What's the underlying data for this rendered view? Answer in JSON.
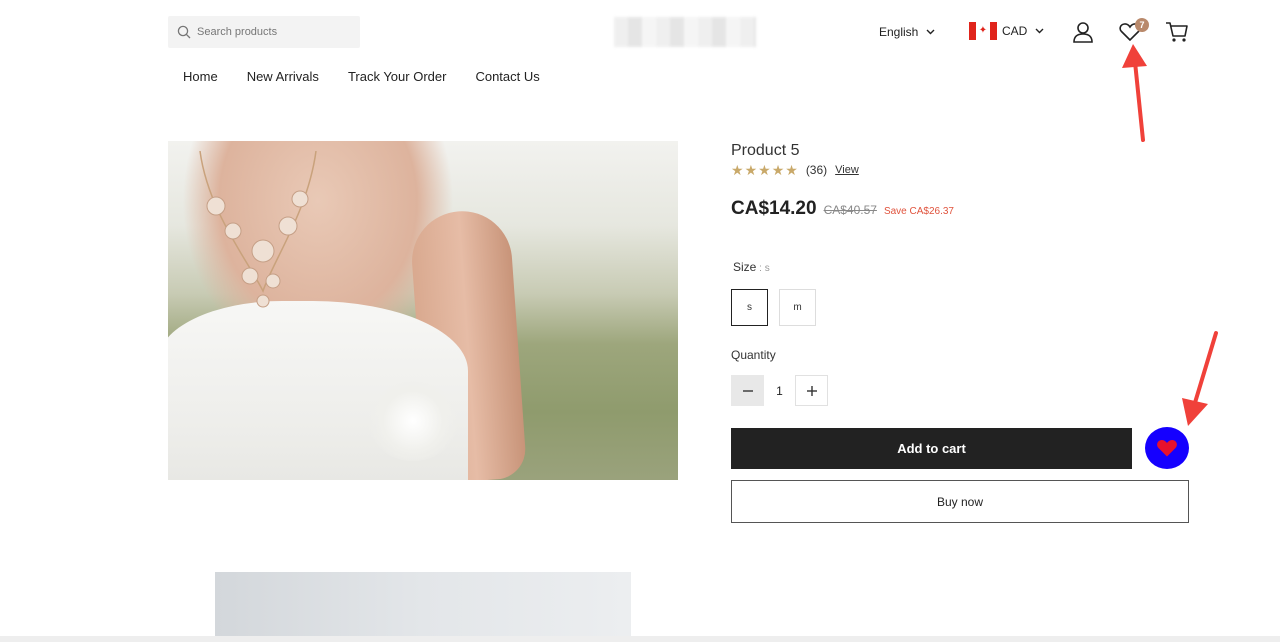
{
  "header": {
    "search_placeholder": "Search products",
    "language": "English",
    "currency": "CAD",
    "wishlist_count": "7"
  },
  "nav": {
    "items": [
      "Home",
      "New Arrivals",
      "Track Your Order",
      "Contact Us"
    ]
  },
  "product": {
    "title": "Product 5",
    "rating_stars": 5,
    "review_count": "(36)",
    "view_label": "View",
    "price": "CA$14.20",
    "compare_price": "CA$40.57",
    "save_label": "Save CA$26.37",
    "size_label": "Size",
    "size_selected": "s",
    "size_options": [
      "s",
      "m"
    ],
    "quantity_label": "Quantity",
    "quantity": "1",
    "add_to_cart_label": "Add to cart",
    "buy_now_label": "Buy now"
  },
  "colors": {
    "accent_dark": "#222222",
    "wishlist_float_bg": "#1500ff",
    "heart_red": "#e8112d",
    "save_red": "#e0533d",
    "star_gold": "#c9a96a",
    "badge": "#b9896b",
    "annotation_arrow": "#f0413a"
  },
  "icons": [
    "search-icon",
    "chevron-down-icon",
    "canada-flag-icon",
    "user-icon",
    "heart-outline-icon",
    "cart-icon",
    "heart-filled-icon",
    "minus-icon",
    "plus-icon"
  ]
}
